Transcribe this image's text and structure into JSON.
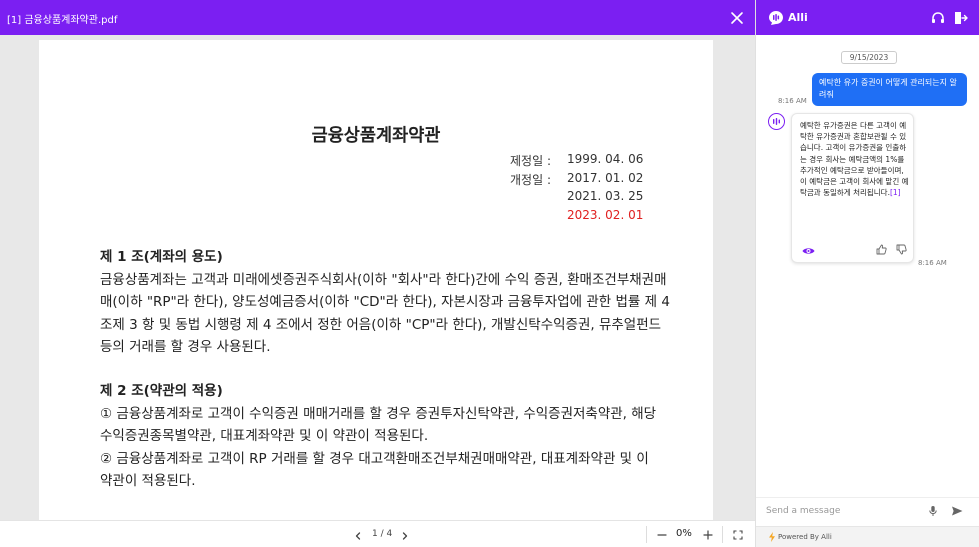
{
  "viewer": {
    "file_name": "[1] 금융상품계좌약관.pdf",
    "close_icon": "close-icon",
    "document": {
      "title": "금융상품계좌약관",
      "dates": [
        {
          "label": "제정일 : ",
          "value": "1999. 04. 06",
          "highlight": false
        },
        {
          "label": "개정일 : ",
          "value": "2017. 01. 02",
          "highlight": false
        },
        {
          "label": "",
          "value": "2021. 03. 25",
          "highlight": false
        },
        {
          "label": "",
          "value": "2023. 02. 01",
          "highlight": true
        }
      ],
      "articles": [
        {
          "heading": "제 1 조(계좌의 용도)",
          "lines": [
            "금융상품계좌는 고객과 미래에셋증권주식회사(이하 \"회사\"라 한다)간에 수익 증권, 환매조건부채권매",
            "매(이하 \"RP\"라 한다), 양도성예금증서(이하 \"CD\"라 한다), 자본시장과 금융투자업에 관한 법률 제 4",
            "조제 3 항 및 동법 시행령 제 4 조에서 정한 어음(이하 \"CP\"라 한다), 개발신탁수익증권, 뮤추얼펀드",
            "등의 거래를 할 경우 사용된다."
          ]
        },
        {
          "heading": "제 2 조(약관의 적용)",
          "lines": [
            "① 금융상품계좌로 고객이 수익증권 매매거래를 할 경우 증권투자신탁약관, 수익증권저축약관, 해당",
            "수익증권종목별약관, 대표계좌약관 및 이 약관이 적용된다.",
            "② 금융상품계좌로 고객이 RP 거래를 할 경우 대고객환매조건부채권매매약관, 대표계좌약관 및 이",
            "약관이 적용된다."
          ]
        }
      ]
    },
    "footer": {
      "page_text": "1 / 4",
      "zoom": "0%",
      "icons": [
        "chevron-left-icon",
        "chevron-right-icon",
        "minus-icon",
        "plus-icon",
        "fullscreen-icon"
      ]
    }
  },
  "chat": {
    "brand": "Alli",
    "header_icons": [
      "headset-icon",
      "exit-icon"
    ],
    "date_chip": "9/15/2023",
    "messages": [
      {
        "role": "user",
        "text": "예탁한 유가 증권이 어떻게 관리되는지 알려줘",
        "time": "8:16 AM"
      },
      {
        "role": "bot",
        "text": "예탁한 유가증권은 다른 고객이 예탁한 유가증권과 혼합보관될 수 있습니다. 고객이 유가증권을 인출하는 경우 회사는 예탁금액의 1%를 추가적인 예탁금으로 받아들이며, 이 예탁금은 고객이 회사에 맡긴 예탁금과 동일하게 처리됩니다.",
        "citation": "[1]",
        "time": "8:16 AM"
      }
    ],
    "input_placeholder": "Send a message",
    "powered_by": "Powered By Alli",
    "colors": {
      "accent": "#7b1ff2",
      "user_bubble": "#1f6ff5",
      "highlight_date": "#e02020"
    }
  }
}
